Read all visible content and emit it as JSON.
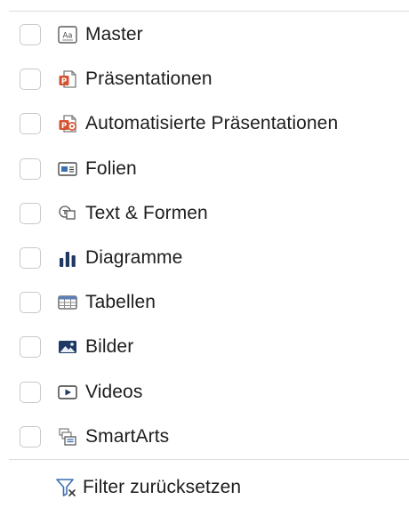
{
  "filters": [
    {
      "label": "Master",
      "icon": "master-template-icon",
      "checked": false
    },
    {
      "label": "Präsentationen",
      "icon": "powerpoint-file-icon",
      "checked": false
    },
    {
      "label": "Automatisierte Präsentationen",
      "icon": "automated-presentation-icon",
      "checked": false
    },
    {
      "label": "Folien",
      "icon": "slide-icon",
      "checked": false
    },
    {
      "label": "Text & Formen",
      "icon": "text-shapes-icon",
      "checked": false
    },
    {
      "label": "Diagramme",
      "icon": "bar-chart-icon",
      "checked": false
    },
    {
      "label": "Tabellen",
      "icon": "table-icon",
      "checked": false
    },
    {
      "label": "Bilder",
      "icon": "image-icon",
      "checked": false
    },
    {
      "label": "Videos",
      "icon": "video-icon",
      "checked": false
    },
    {
      "label": "SmartArts",
      "icon": "smartart-icon",
      "checked": false
    }
  ],
  "reset": {
    "label": "Filter zurücksetzen",
    "icon": "filter-clear-icon"
  },
  "colors": {
    "accent_orange": "#d35230",
    "chart_navy": "#1f3864",
    "text": "#1d1d1f",
    "checkbox_border": "#c9c9c9",
    "divider": "#dcdcdc"
  }
}
